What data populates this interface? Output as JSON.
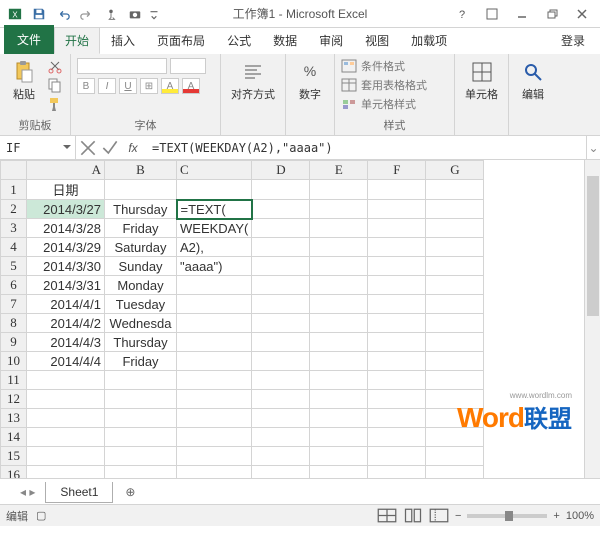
{
  "title": "工作簿1 - Microsoft Excel",
  "qat_icons": [
    "excel-icon",
    "save-icon",
    "undo-icon",
    "redo-icon",
    "touch-icon",
    "camera-icon"
  ],
  "window_buttons": [
    "help-icon",
    "ribbon-collapse-icon",
    "minimize-icon",
    "restore-icon",
    "close-icon"
  ],
  "tabs": {
    "file": "文件",
    "home": "开始",
    "insert": "插入",
    "layout": "页面布局",
    "formulas": "公式",
    "data": "数据",
    "review": "审阅",
    "view": "视图",
    "addins": "加载项",
    "login": "登录"
  },
  "ribbon_groups": {
    "clipboard": {
      "label": "剪贴板",
      "paste": "粘贴"
    },
    "font": {
      "label": "字体"
    },
    "alignment": {
      "label": "对齐方式",
      "btn": "对齐方式"
    },
    "number": {
      "label": "数字",
      "btn": "数字"
    },
    "styles": {
      "label": "样式",
      "cond": "条件格式",
      "table": "套用表格格式",
      "cell": "单元格样式"
    },
    "cells": {
      "label": "单元格",
      "btn": "单元格"
    },
    "editing": {
      "label": "编辑",
      "btn": "编辑"
    }
  },
  "name_box": "IF",
  "formula_bar": "=TEXT(WEEKDAY(A2),\"aaaa\")",
  "columns": [
    "A",
    "B",
    "C",
    "D",
    "E",
    "F",
    "G"
  ],
  "header": "日期",
  "rows": [
    {
      "n": 1,
      "a": "日期",
      "b": "",
      "c": ""
    },
    {
      "n": 2,
      "a": "2014/3/27",
      "b": "Thursday",
      "c": "=TEXT("
    },
    {
      "n": 3,
      "a": "2014/3/28",
      "b": "Friday",
      "c": "WEEKDAY("
    },
    {
      "n": 4,
      "a": "2014/3/29",
      "b": "Saturday",
      "c": "A2),"
    },
    {
      "n": 5,
      "a": "2014/3/30",
      "b": "Sunday",
      "c": "\"aaaa\")"
    },
    {
      "n": 6,
      "a": "2014/3/31",
      "b": "Monday",
      "c": ""
    },
    {
      "n": 7,
      "a": "2014/4/1",
      "b": "Tuesday",
      "c": ""
    },
    {
      "n": 8,
      "a": "2014/4/2",
      "b": "Wednesda",
      "c": ""
    },
    {
      "n": 9,
      "a": "2014/4/3",
      "b": "Thursday",
      "c": ""
    },
    {
      "n": 10,
      "a": "2014/4/4",
      "b": "Friday",
      "c": ""
    },
    {
      "n": 11,
      "a": "",
      "b": "",
      "c": ""
    },
    {
      "n": 12,
      "a": "",
      "b": "",
      "c": ""
    },
    {
      "n": 13,
      "a": "",
      "b": "",
      "c": ""
    },
    {
      "n": 14,
      "a": "",
      "b": "",
      "c": ""
    },
    {
      "n": 15,
      "a": "",
      "b": "",
      "c": ""
    },
    {
      "n": 16,
      "a": "",
      "b": "",
      "c": ""
    }
  ],
  "sheet_tab": "Sheet1",
  "status": "编辑",
  "zoom": "100%",
  "watermark": {
    "w1": "Word",
    "w2": "联盟",
    "url": "www.wordlm.com"
  }
}
